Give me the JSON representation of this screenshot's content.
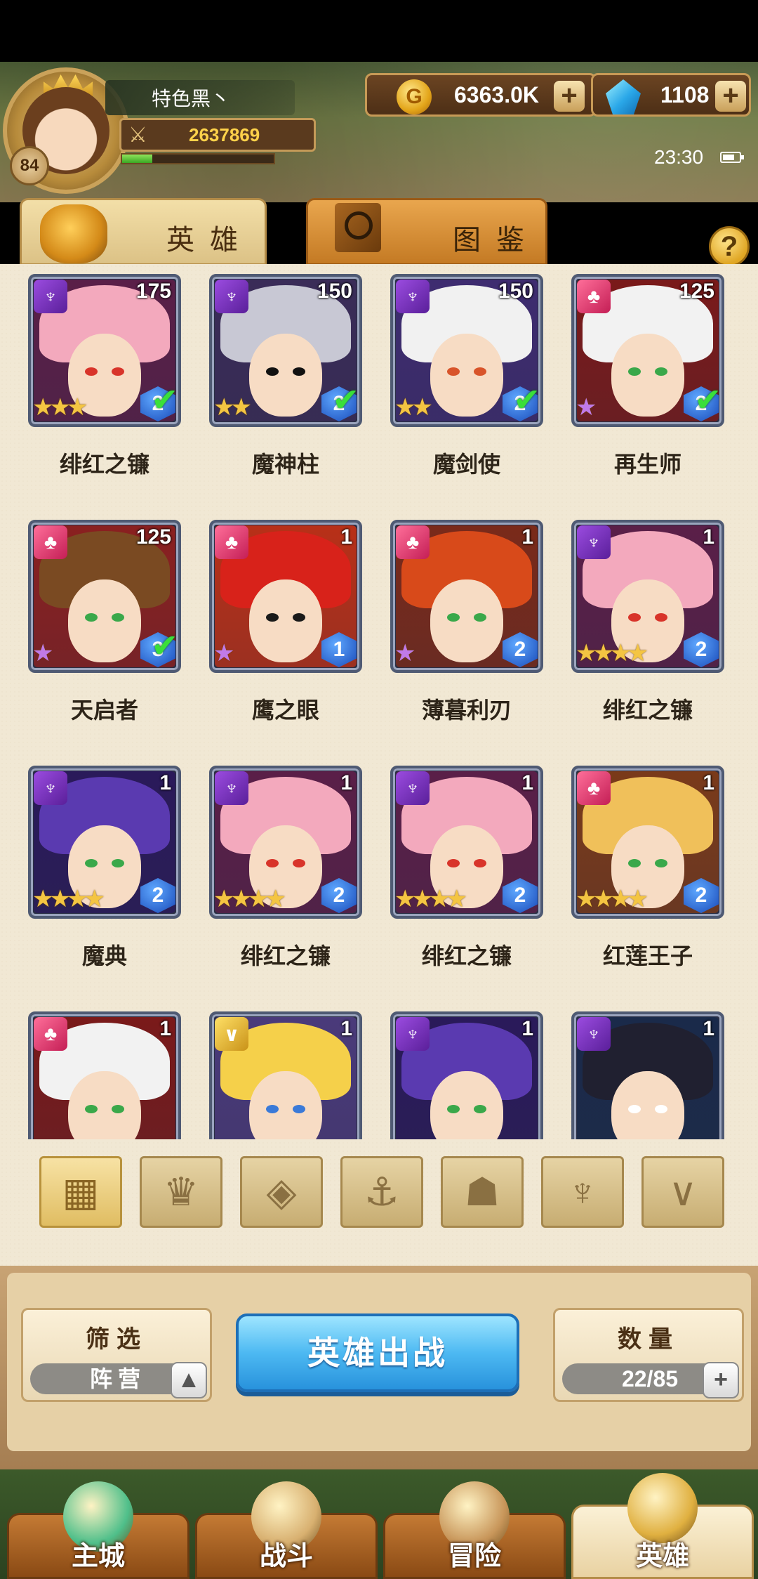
{
  "player": {
    "name": "特色黑丶",
    "level": "84",
    "power": "2637869",
    "xp_fraction": 0.2
  },
  "currency": {
    "gold": "6363.0K",
    "gems": "1108"
  },
  "status": {
    "time": "23:30"
  },
  "tabs": {
    "heroes": "英雄",
    "codex": "图鉴"
  },
  "heroes": [
    {
      "name": "绯红之镰",
      "level": "175",
      "faction": "purple",
      "stars": 3,
      "rank": "2",
      "checked": true,
      "hair": "#f3a9bd",
      "eye": "#d8342a",
      "bg": "#5a1f48"
    },
    {
      "name": "魔神柱",
      "level": "150",
      "faction": "purple",
      "stars": 2,
      "rank": "2",
      "checked": true,
      "hair": "#c8c8d4",
      "eye": "#111111",
      "bg": "#3a2c58"
    },
    {
      "name": "魔剑使",
      "level": "150",
      "faction": "purple",
      "stars": 2,
      "rank": "2",
      "checked": true,
      "hair": "#f1f1f1",
      "eye": "#d8542a",
      "bg": "#3e2c70"
    },
    {
      "name": "再生师",
      "level": "125",
      "faction": "pink",
      "stars": 1,
      "rank": "2",
      "checked": true,
      "hair": "#f2f2f2",
      "eye": "#3aa84a",
      "bg": "#7a1a1a"
    },
    {
      "name": "天启者",
      "level": "125",
      "faction": "pink",
      "stars": 1,
      "rank": "3",
      "checked": true,
      "hair": "#7a4a22",
      "eye": "#3aa84a",
      "bg": "#8a2020"
    },
    {
      "name": "鹰之眼",
      "level": "1",
      "faction": "pink",
      "stars": 1,
      "rank": "1",
      "checked": false,
      "hair": "#d8221a",
      "eye": "#1a1a1a",
      "bg": "#b83018"
    },
    {
      "name": "薄暮利刃",
      "level": "1",
      "faction": "pink",
      "stars": 1,
      "rank": "2",
      "checked": false,
      "hair": "#d84a1a",
      "eye": "#3aa84a",
      "bg": "#7a2a1a"
    },
    {
      "name": "绯红之镰",
      "level": "1",
      "faction": "purple",
      "stars": 4,
      "rank": "2",
      "checked": false,
      "hair": "#f3a9bd",
      "eye": "#d8342a",
      "bg": "#5a1f48"
    },
    {
      "name": "魔典",
      "level": "1",
      "faction": "purple",
      "stars": 4,
      "rank": "2",
      "checked": false,
      "hair": "#5a3ab0",
      "eye": "#3aa84a",
      "bg": "#2a1a5a"
    },
    {
      "name": "绯红之镰",
      "level": "1",
      "faction": "purple",
      "stars": 4,
      "rank": "2",
      "checked": false,
      "hair": "#f3a9bd",
      "eye": "#d8342a",
      "bg": "#5a1f48"
    },
    {
      "name": "绯红之镰",
      "level": "1",
      "faction": "purple",
      "stars": 4,
      "rank": "2",
      "checked": false,
      "hair": "#f3a9bd",
      "eye": "#d8342a",
      "bg": "#5a1f48"
    },
    {
      "name": "红莲王子",
      "level": "1",
      "faction": "pink",
      "stars": 4,
      "rank": "2",
      "checked": false,
      "hair": "#f0c05a",
      "eye": "#3aa84a",
      "bg": "#7a3a1a"
    },
    {
      "name": "",
      "level": "1",
      "faction": "pink",
      "stars": 0,
      "rank": "",
      "checked": false,
      "hair": "#f2f2f2",
      "eye": "#3aa84a",
      "bg": "#7a1a1a"
    },
    {
      "name": "",
      "level": "1",
      "faction": "gold",
      "stars": 0,
      "rank": "",
      "checked": false,
      "hair": "#f5d04a",
      "eye": "#3a7ad8",
      "bg": "#4a3a7a"
    },
    {
      "name": "",
      "level": "1",
      "faction": "purple",
      "stars": 0,
      "rank": "",
      "checked": false,
      "hair": "#5a3ab0",
      "eye": "#3aa84a",
      "bg": "#2a1a5a"
    },
    {
      "name": "",
      "level": "1",
      "faction": "purple",
      "stars": 0,
      "rank": "",
      "checked": false,
      "hair": "#202030",
      "eye": "#ffffff",
      "bg": "#1a2a4a"
    }
  ],
  "filters": [
    {
      "icon": "grid-all-icon",
      "glyph": "▦",
      "active": true
    },
    {
      "icon": "faction-leaf-icon",
      "glyph": "♛",
      "active": false
    },
    {
      "icon": "faction-diamond-icon",
      "glyph": "◈",
      "active": false
    },
    {
      "icon": "faction-anchor-icon",
      "glyph": "⚓",
      "active": false
    },
    {
      "icon": "faction-beast-icon",
      "glyph": "☗",
      "active": false
    },
    {
      "icon": "faction-demon-icon",
      "glyph": "♆",
      "active": false
    },
    {
      "icon": "faction-v-icon",
      "glyph": "∨",
      "active": false
    }
  ],
  "bottom": {
    "filter_title": "筛选",
    "filter_value": "阵营",
    "deploy_label": "英雄出战",
    "count_title": "数量",
    "count_value": "22/85"
  },
  "nav": [
    {
      "label": "主城",
      "icon": "city-icon",
      "active": false
    },
    {
      "label": "战斗",
      "icon": "crossed-swords-icon",
      "active": false
    },
    {
      "label": "冒险",
      "icon": "scroll-map-icon",
      "active": false
    },
    {
      "label": "英雄",
      "icon": "hero-crest-icon",
      "active": true
    }
  ],
  "colors": {
    "accent_blue": "#4db9f2",
    "gold": "#ffd24a",
    "panel": "#f1e8d4"
  }
}
